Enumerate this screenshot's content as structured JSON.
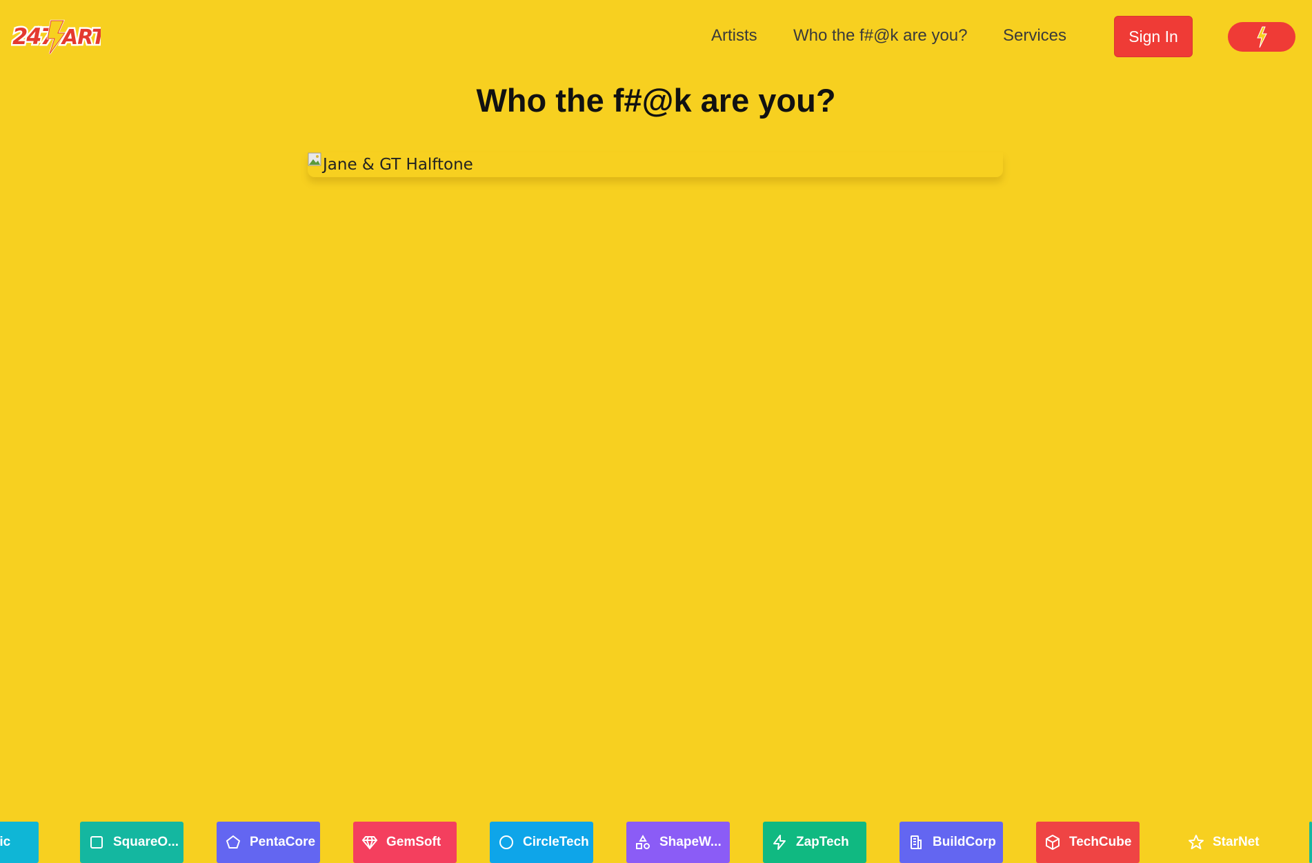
{
  "header": {
    "logo_text": "247ART",
    "nav": [
      {
        "label": "Artists"
      },
      {
        "label": "Who the f#@k are you?"
      },
      {
        "label": "Services"
      }
    ],
    "sign_in_label": "Sign In",
    "bolt_icon": "lightning-bolt-icon"
  },
  "main": {
    "title": "Who the f#@k are you?",
    "image_alt": "Jane & GT Halftone"
  },
  "ticker": {
    "items": [
      {
        "label": "xLogic",
        "color": "#0fb6d6",
        "icon": "none"
      },
      {
        "label": "SquareO...",
        "color": "#14b7a0",
        "icon": "square-icon"
      },
      {
        "label": "PentaCore",
        "color": "#6366f1",
        "icon": "pentagon-icon"
      },
      {
        "label": "GemSoft",
        "color": "#f43f5e",
        "icon": "gem-icon"
      },
      {
        "label": "CircleTech",
        "color": "#0ea5e9",
        "icon": "circle-icon"
      },
      {
        "label": "ShapeW...",
        "color": "#8b5cf6",
        "icon": "shapes-icon"
      },
      {
        "label": "ZapTech",
        "color": "#10b981",
        "icon": "zap-icon"
      },
      {
        "label": "BuildCorp",
        "color": "#6366f1",
        "icon": "building-icon"
      },
      {
        "label": "TechCube",
        "color": "#ef4444",
        "icon": "cube-icon"
      },
      {
        "label": "StarNet",
        "color": "#f7d020",
        "icon": "star-icon"
      }
    ]
  }
}
